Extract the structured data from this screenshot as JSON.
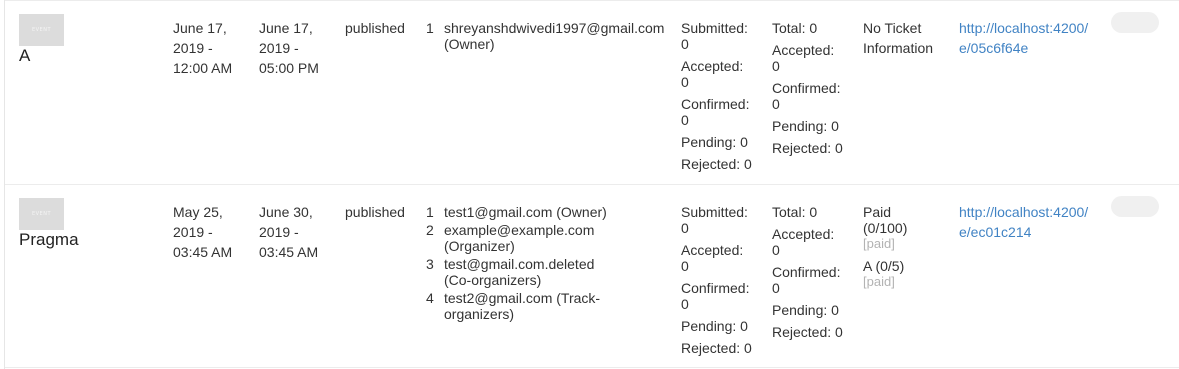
{
  "events": [
    {
      "thumbnail_text": "EVENT",
      "name": "A",
      "starts_at": [
        "June 17,",
        "2019 -",
        "12:00 AM"
      ],
      "ends_at": [
        "June 17,",
        "2019 -",
        "05:00 PM"
      ],
      "state": "published",
      "roles": [
        {
          "num": "1",
          "text": "shreyanshdwivedi1997@gmail.com (Owner)"
        }
      ],
      "sessions": [
        {
          "label": "Submitted:",
          "value": "0"
        },
        {
          "label": "Accepted:",
          "value": "0"
        },
        {
          "label": "Confirmed:",
          "value": "0"
        },
        {
          "label": "Pending:",
          "value": "0",
          "inline": true
        },
        {
          "label": "Rejected:",
          "value": "0",
          "inline": true
        }
      ],
      "speakers": [
        {
          "label": "Total:",
          "value": "0",
          "inline": true
        },
        {
          "label": "Accepted:",
          "value": "0"
        },
        {
          "label": "Confirmed:",
          "value": "0"
        },
        {
          "label": "Pending:",
          "value": "0",
          "inline": true
        },
        {
          "label": "Rejected:",
          "value": "0",
          "inline": true
        }
      ],
      "tickets_text": "No Ticket Information",
      "tickets": [],
      "public_url": "http://localhost:4200/e/05c6f64e"
    },
    {
      "thumbnail_text": "EVENT",
      "name": "Pragma",
      "starts_at": [
        "May 25,",
        "2019 -",
        "03:45 AM"
      ],
      "ends_at": [
        "June 30,",
        "2019 -",
        "03:45 AM"
      ],
      "state": "published",
      "roles": [
        {
          "num": "1",
          "text": "test1@gmail.com (Owner)"
        },
        {
          "num": "2",
          "text": "example@example.com (Organizer)"
        },
        {
          "num": "3",
          "text": "test@gmail.com.deleted (Co-organizers)"
        },
        {
          "num": "4",
          "text": "test2@gmail.com (Track-organizers)"
        }
      ],
      "sessions": [
        {
          "label": "Submitted:",
          "value": "0"
        },
        {
          "label": "Accepted:",
          "value": "0"
        },
        {
          "label": "Confirmed:",
          "value": "0"
        },
        {
          "label": "Pending:",
          "value": "0",
          "inline": true
        },
        {
          "label": "Rejected:",
          "value": "0",
          "inline": true
        }
      ],
      "speakers": [
        {
          "label": "Total:",
          "value": "0",
          "inline": true
        },
        {
          "label": "Accepted:",
          "value": "0"
        },
        {
          "label": "Confirmed:",
          "value": "0"
        },
        {
          "label": "Pending:",
          "value": "0",
          "inline": true
        },
        {
          "label": "Rejected:",
          "value": "0",
          "inline": true
        }
      ],
      "tickets_text": "",
      "tickets": [
        {
          "name": "Paid",
          "count": "(0/100)",
          "type": "[paid]"
        },
        {
          "name": "A",
          "count": "(0/5)",
          "type": "[paid]"
        }
      ],
      "public_url": "http://localhost:4200/e/ec01c214"
    }
  ],
  "colors": {
    "link": "#4183c4",
    "muted": "#b3b3b3",
    "toggle": "#f0f0f0",
    "divider": "#ececec"
  }
}
